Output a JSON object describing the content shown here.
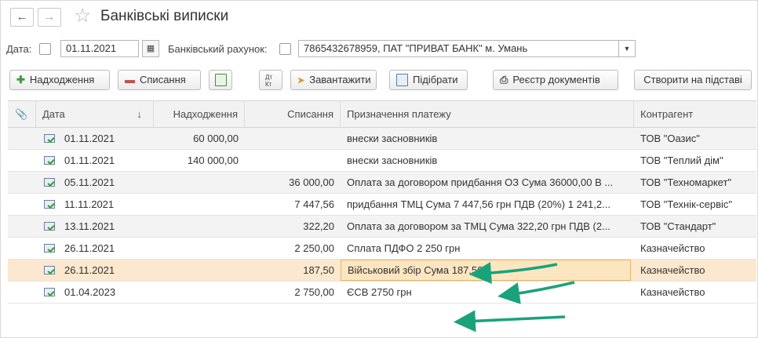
{
  "window": {
    "title": "Банківські виписки"
  },
  "filters": {
    "date_label": "Дата:",
    "date_value": "01.11.2021",
    "account_label": "Банківський рахунок:",
    "account_value": "7865432678959, ПАТ \"ПРИВАТ БАНК\" м. Умань"
  },
  "toolbar": {
    "income": "Надходження",
    "expense": "Списання",
    "load": "Завантажити",
    "pick": "Підібрати",
    "registry": "Реєстр документів",
    "create_based": "Створити на підставі"
  },
  "table": {
    "columns": [
      "Дата",
      "Надходження",
      "Списання",
      "Призначення платежу",
      "Контрагент"
    ],
    "sort_indicator": "↓",
    "rows": [
      {
        "date": "01.11.2021",
        "income": "60 000,00",
        "expense": "",
        "purpose": "внески засновників",
        "counterparty": "ТОВ \"Оазис\""
      },
      {
        "date": "01.11.2021",
        "income": "140 000,00",
        "expense": "",
        "purpose": "внески засновників",
        "counterparty": "ТОВ \"Теплий дім\""
      },
      {
        "date": "05.11.2021",
        "income": "",
        "expense": "36 000,00",
        "purpose": "Оплата за договором придбання ОЗ Сума 36000,00 В ...",
        "counterparty": "ТОВ \"Техномаркет\""
      },
      {
        "date": "11.11.2021",
        "income": "",
        "expense": "7 447,56",
        "purpose": "придбання ТМЦ Сума 7 447,56 грн ПДВ (20%) 1 241,2...",
        "counterparty": "ТОВ \"Технік-сервіс\""
      },
      {
        "date": "13.11.2021",
        "income": "",
        "expense": "322,20",
        "purpose": "Оплата за договором за ТМЦ Сума 322,20 грн ПДВ (2...",
        "counterparty": "ТОВ \"Стандарт\""
      },
      {
        "date": "26.11.2021",
        "income": "",
        "expense": "2 250,00",
        "purpose": "Сплата ПДФО 2 250 грн",
        "counterparty": "Казначейство"
      },
      {
        "date": "26.11.2021",
        "income": "",
        "expense": "187,50",
        "purpose": "Військовий збір Сума 187,50",
        "counterparty": "Казначейство"
      },
      {
        "date": "01.04.2023",
        "income": "",
        "expense": "2 750,00",
        "purpose": "ЄСВ 2750 грн",
        "counterparty": "Казначейство"
      }
    ]
  },
  "colors": {
    "selected_row": "#fbe8cf",
    "annotation_arrow": "#1aa37a"
  }
}
